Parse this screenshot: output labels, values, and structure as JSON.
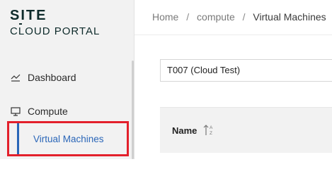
{
  "sidebar": {
    "logo": {
      "line1": "SITE",
      "line2": "CLOUD PORTAL"
    },
    "items": [
      {
        "label": "Dashboard",
        "icon": "chart-line-icon"
      },
      {
        "label": "Compute",
        "icon": "monitor-icon"
      }
    ],
    "sub_items": [
      {
        "label": "Virtual Machines",
        "active": true
      }
    ],
    "accent_color": "#2a66b8",
    "highlight_color": "#e3202b"
  },
  "main": {
    "breadcrumb": {
      "items": [
        "Home",
        "compute",
        "Virtual Machines"
      ],
      "separator": "/"
    },
    "tenant_select": {
      "value": "T007 (Cloud Test)"
    },
    "table": {
      "columns": [
        {
          "label": "Name",
          "sort_icon": "sort-alpha-icon"
        }
      ]
    }
  }
}
